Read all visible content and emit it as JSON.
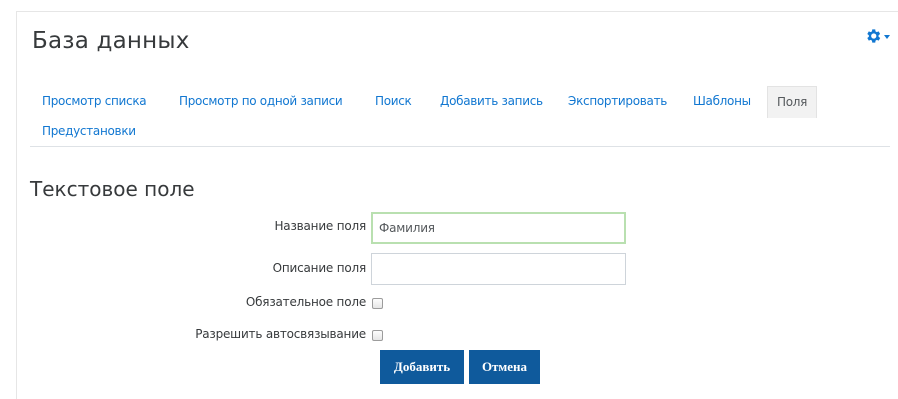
{
  "header": {
    "title": "База данных",
    "settings_icon": "gear-icon"
  },
  "tabs": [
    {
      "label": "Просмотр списка",
      "active": false
    },
    {
      "label": "Просмотр по одной записи",
      "active": false
    },
    {
      "label": "Поиск",
      "active": false
    },
    {
      "label": "Добавить запись",
      "active": false
    },
    {
      "label": "Экспортировать",
      "active": false
    },
    {
      "label": "Шаблоны",
      "active": false
    },
    {
      "label": "Поля",
      "active": true
    },
    {
      "label": "Предустановки",
      "active": false
    }
  ],
  "form": {
    "title": "Текстовое поле",
    "field_name": {
      "label": "Название поля",
      "value": "Фамилия"
    },
    "field_description": {
      "label": "Описание поля",
      "value": ""
    },
    "required": {
      "label": "Обязательное поле",
      "checked": false
    },
    "autolink": {
      "label": "Разрешить автосвязывание",
      "checked": false
    },
    "submit_label": "Добавить",
    "cancel_label": "Отмена"
  },
  "colors": {
    "link": "#1177d1",
    "button": "#0f5a9c",
    "focus_border": "#b9e0b0"
  }
}
